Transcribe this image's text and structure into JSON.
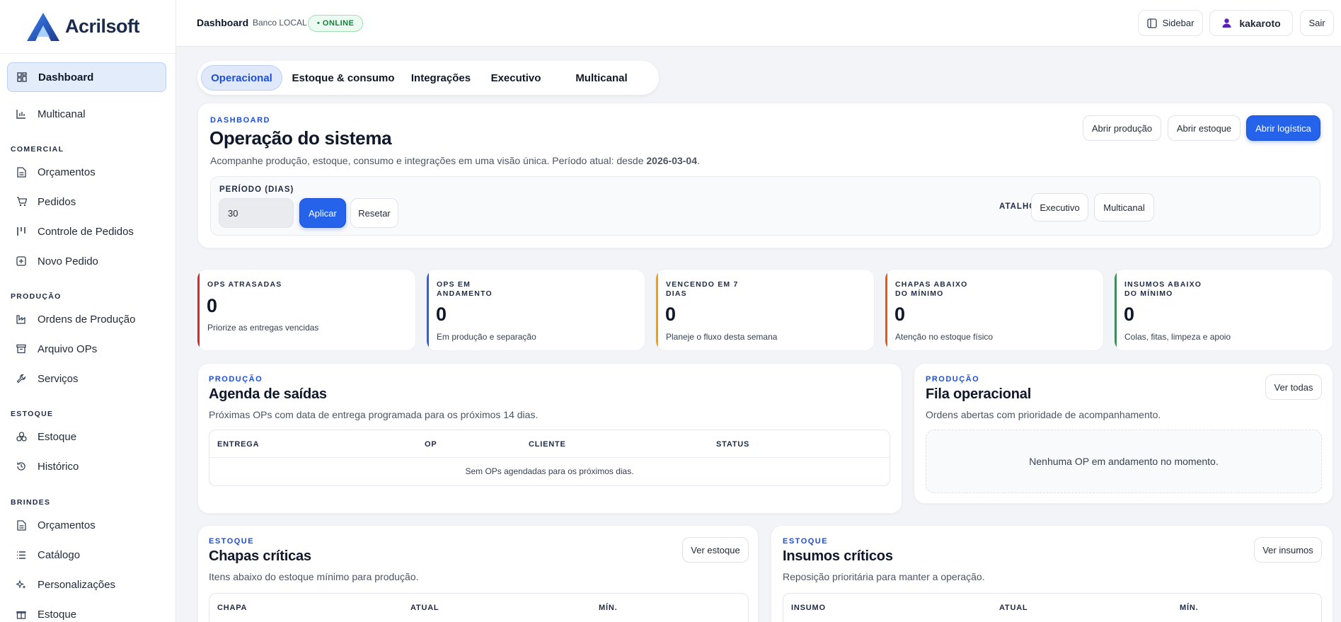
{
  "brand": {
    "name": "Acrilsoft"
  },
  "sidebar": {
    "main": [
      {
        "label": "Dashboard",
        "icon": "dashboard-icon"
      },
      {
        "label": "Multicanal",
        "icon": "bar-chart-icon"
      }
    ],
    "sections": [
      {
        "title": "COMERCIAL",
        "items": [
          {
            "label": "Orçamentos"
          },
          {
            "label": "Pedidos"
          },
          {
            "label": "Controle de Pedidos"
          },
          {
            "label": "Novo Pedido"
          }
        ]
      },
      {
        "title": "PRODUÇÃO",
        "items": [
          {
            "label": "Ordens de Produção"
          },
          {
            "label": "Arquivo OPs"
          },
          {
            "label": "Serviços"
          }
        ]
      },
      {
        "title": "ESTOQUE",
        "items": [
          {
            "label": "Estoque"
          },
          {
            "label": "Histórico"
          }
        ]
      },
      {
        "title": "BRINDES",
        "items": [
          {
            "label": "Orçamentos"
          },
          {
            "label": "Catálogo"
          },
          {
            "label": "Personalizações"
          },
          {
            "label": "Estoque"
          }
        ]
      }
    ]
  },
  "topbar": {
    "title": "Dashboard",
    "subtitle": "Banco LOCAL",
    "status": "• ONLINE",
    "sidebar_label": "Sidebar",
    "user": "kakaroto",
    "logout": "Sair"
  },
  "tabs": [
    {
      "label": "Operacional"
    },
    {
      "label": "Estoque & consumo"
    },
    {
      "label": "Integrações"
    },
    {
      "label": "Executivo"
    },
    {
      "label": "Multicanal"
    }
  ],
  "hero": {
    "eyebrow": "DASHBOARD",
    "title": "Operação do sistema",
    "desc_prefix": "Acompanhe produção, estoque, consumo e integrações em uma visão única. Período atual: desde ",
    "desc_date": "2026-03-04",
    "desc_suffix": ".",
    "actions": {
      "producao": "Abrir produção",
      "estoque": "Abrir estoque",
      "logistica": "Abrir logística"
    },
    "period_label": "PERÍODO (DIAS)",
    "period_value": "30",
    "apply": "Aplicar",
    "reset": "Resetar",
    "shortcuts_label": "ATALHOS",
    "shortcut1": "Executivo",
    "shortcut2": "Multicanal"
  },
  "kpis": [
    {
      "label": "OPS ATRASADAS",
      "value": "0",
      "note": "Priorize as entregas vencidas",
      "color": "#dc2626"
    },
    {
      "label": "OPS EM ANDAMENTO",
      "value": "0",
      "note": "Em produção e separação",
      "color": "#2563eb"
    },
    {
      "label": "VENCENDO EM 7 DIAS",
      "value": "0",
      "note": "Planeje o fluxo desta semana",
      "color": "#f59e0b"
    },
    {
      "label": "CHAPAS ABAIXO DO MÍNIMO",
      "value": "0",
      "note": "Atenção no estoque físico",
      "color": "#ea580c"
    },
    {
      "label": "INSUMOS ABAIXO DO MÍNIMO",
      "value": "0",
      "note": "Colas, fitas, limpeza e apoio",
      "color": "#16a34a"
    }
  ],
  "agenda": {
    "eyebrow": "PRODUÇÃO",
    "title": "Agenda de saídas",
    "desc": "Próximas OPs com data de entrega programada para os próximos 14 dias.",
    "columns": [
      "ENTREGA",
      "OP",
      "CLIENTE",
      "STATUS"
    ],
    "empty": "Sem OPs agendadas para os próximos dias."
  },
  "fila": {
    "eyebrow": "PRODUÇÃO",
    "title": "Fila operacional",
    "desc": "Ordens abertas com prioridade de acompanhamento.",
    "button": "Ver todas",
    "empty": "Nenhuma OP em andamento no momento."
  },
  "chapas": {
    "eyebrow": "ESTOQUE",
    "title": "Chapas críticas",
    "desc": "Itens abaixo do estoque mínimo para produção.",
    "button": "Ver estoque",
    "columns": [
      "CHAPA",
      "ATUAL",
      "MÍN."
    ]
  },
  "insumos": {
    "eyebrow": "ESTOQUE",
    "title": "Insumos críticos",
    "desc": "Reposição prioritária para manter a operação.",
    "button": "Ver insumos",
    "columns": [
      "INSUMO",
      "ATUAL",
      "MÍN."
    ]
  }
}
